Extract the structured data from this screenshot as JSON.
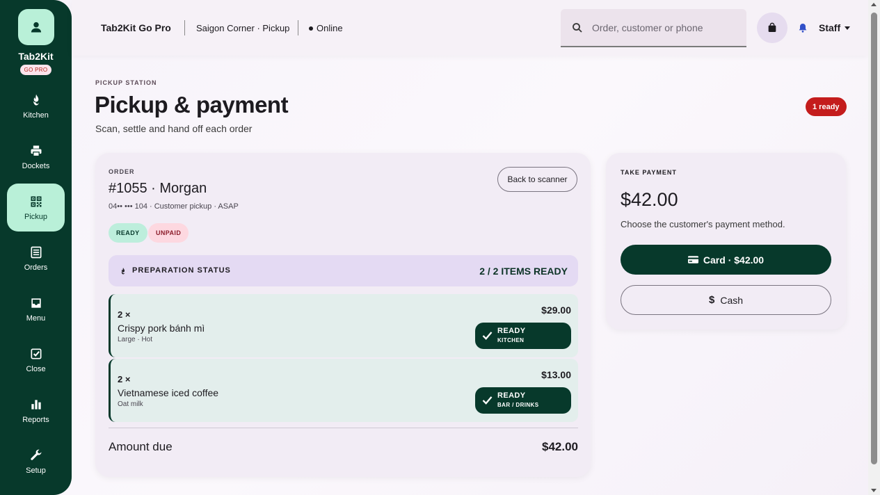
{
  "sidebar": {
    "brand_name": "Tab2Kit",
    "brand_badge": "GO PRO",
    "items": [
      {
        "label": "Kitchen",
        "icon": "flame-icon",
        "active": false
      },
      {
        "label": "Dockets",
        "icon": "printer-icon",
        "active": false
      },
      {
        "label": "Pickup",
        "icon": "qr-code-icon",
        "active": true
      },
      {
        "label": "Orders",
        "icon": "list-icon",
        "active": false
      },
      {
        "label": "Menu",
        "icon": "inbox-icon",
        "active": false
      },
      {
        "label": "Close",
        "icon": "checkbox-icon",
        "active": false
      },
      {
        "label": "Reports",
        "icon": "bar-chart-icon",
        "active": false
      },
      {
        "label": "Setup",
        "icon": "wrench-icon",
        "active": false
      }
    ]
  },
  "topbar": {
    "app_title": "Tab2Kit Go Pro",
    "location": "Saigon Corner · Pickup",
    "status": "Online",
    "search_placeholder": "Order, customer or phone",
    "user": "Staff"
  },
  "page": {
    "eyebrow": "PICKUP STATION",
    "title": "Pickup & payment",
    "subtitle": "Scan, settle and hand off each order",
    "ready_badge": "1 ready"
  },
  "order": {
    "eyebrow": "ORDER",
    "title": "#1055 · Morgan",
    "meta": "04•• ••• 104 · Customer pickup · ASAP",
    "back_button": "Back to scanner",
    "chips": {
      "ready": "READY",
      "unpaid": "UNPAID"
    },
    "prep_label": "PREPARATION STATUS",
    "prep_count": "2 / 2 ITEMS READY",
    "items": [
      {
        "qty": "2 ×",
        "name": "Crispy pork bánh mì",
        "mods": "Large · Hot",
        "price": "$29.00",
        "status": "READY",
        "station": "KITCHEN"
      },
      {
        "qty": "2 ×",
        "name": "Vietnamese iced coffee",
        "mods": "Oat milk",
        "price": "$13.00",
        "status": "READY",
        "station": "BAR / DRINKS"
      }
    ],
    "amount_label": "Amount due",
    "amount_value": "$42.00"
  },
  "payment": {
    "eyebrow": "TAKE PAYMENT",
    "total": "$42.00",
    "hint": "Choose the customer's payment method.",
    "card_button": "Card · $42.00",
    "cash_button": "Cash",
    "cash_symbol": "$"
  },
  "colors": {
    "sidebar": "#07392b",
    "active_nav": "#b9f0d8",
    "danger": "#c41c1c",
    "card_bg": "#f2ecf5"
  }
}
